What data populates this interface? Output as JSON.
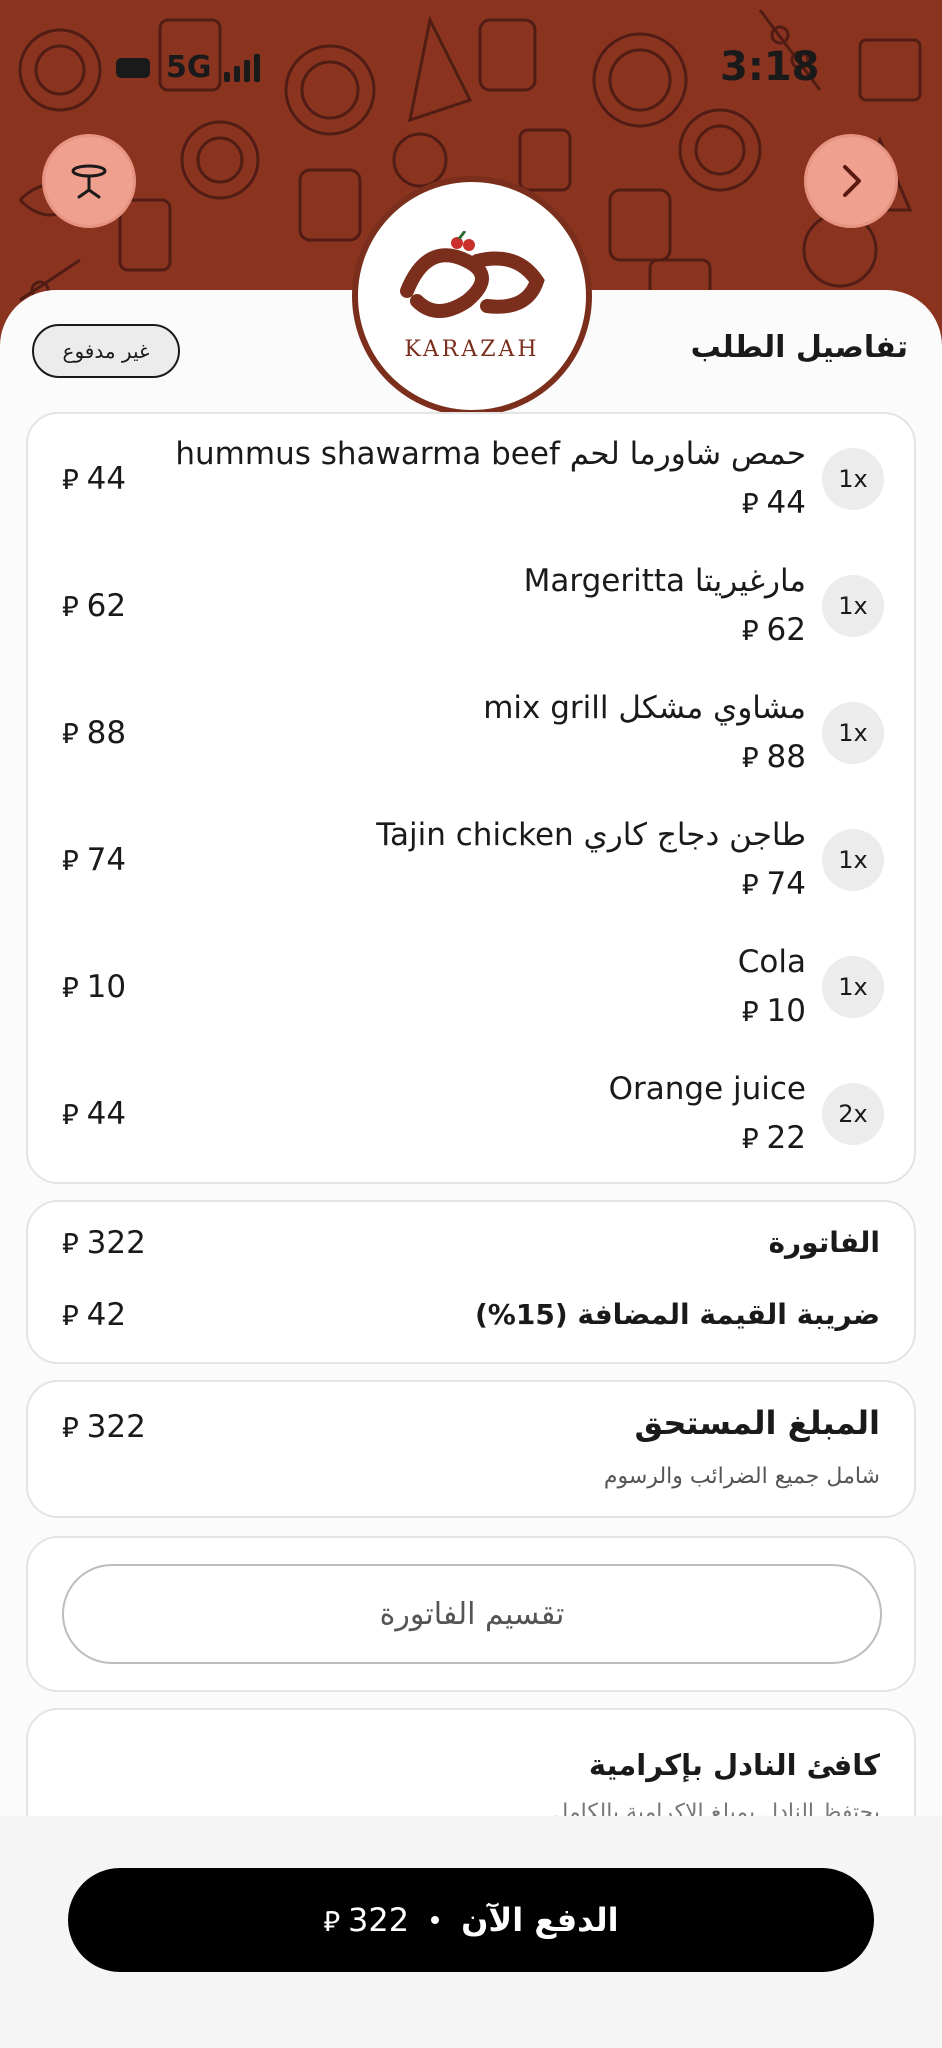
{
  "status_bar": {
    "network": "5G",
    "time": "3:18",
    "icons": [
      "battery-icon",
      "signal-icon"
    ]
  },
  "header": {
    "logo_text": "KARAZAH",
    "left_icon": "table-icon",
    "right_icon": "chevron-right-icon"
  },
  "order": {
    "title": "تفاصيل الطلب",
    "payment_status": "غير مدفوع",
    "currency_symbol": "⃁",
    "items": [
      {
        "qty": "1x",
        "name": "حمص شاورما لحم hummus shawarma beef",
        "unit_price": "44",
        "total": "44"
      },
      {
        "qty": "1x",
        "name": "مارغيريتا Margeritta",
        "unit_price": "62",
        "total": "62"
      },
      {
        "qty": "1x",
        "name": "مشاوي مشكل mix grill",
        "unit_price": "88",
        "total": "88"
      },
      {
        "qty": "1x",
        "name": "طاجن دجاج كاري Tajin chicken",
        "unit_price": "74",
        "total": "74"
      },
      {
        "qty": "1x",
        "name": "Cola",
        "unit_price": "10",
        "total": "10"
      },
      {
        "qty": "2x",
        "name": "Orange juice",
        "unit_price": "22",
        "total": "44"
      }
    ]
  },
  "bill": {
    "invoice_label": "الفاتورة",
    "invoice_value": "322",
    "vat_label": "ضريبة القيمة المضافة (15%)",
    "vat_value": "42"
  },
  "amount_due": {
    "label": "المبلغ المستحق",
    "note": "شامل جميع الضرائب والرسوم",
    "value": "322"
  },
  "split": {
    "label": "تقسيم الفاتورة"
  },
  "tip": {
    "title": "كافئ النادل بإكرامية",
    "note": "يحتفظ النادل بمبلغ الإكرامية بالكامل"
  },
  "pay": {
    "label": "الدفع الآن",
    "amount": "322"
  },
  "colors": {
    "brand": "#8a3420",
    "accent": "#f0a08e",
    "primary_button": "#000000"
  }
}
